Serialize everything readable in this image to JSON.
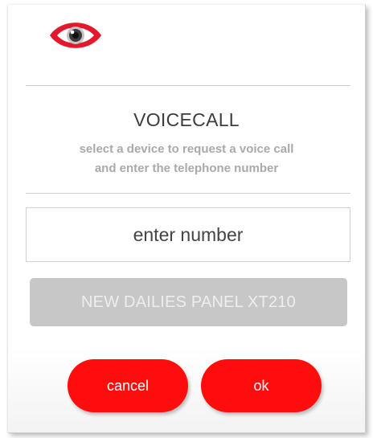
{
  "logo": {
    "icon": "eye-icon",
    "color": "#e3182d"
  },
  "dialog": {
    "title": "VOICECALL",
    "subtitle_line1": "select a device to request a voice call",
    "subtitle_line2": "and enter the telephone number"
  },
  "number_field": {
    "placeholder": "enter number",
    "value": ""
  },
  "device_button": {
    "label": "NEW DAILIES PANEL XT210"
  },
  "actions": {
    "cancel_label": "cancel",
    "ok_label": "ok"
  },
  "colors": {
    "accent": "#ff0d0d",
    "disabled": "#c7c7c7"
  }
}
